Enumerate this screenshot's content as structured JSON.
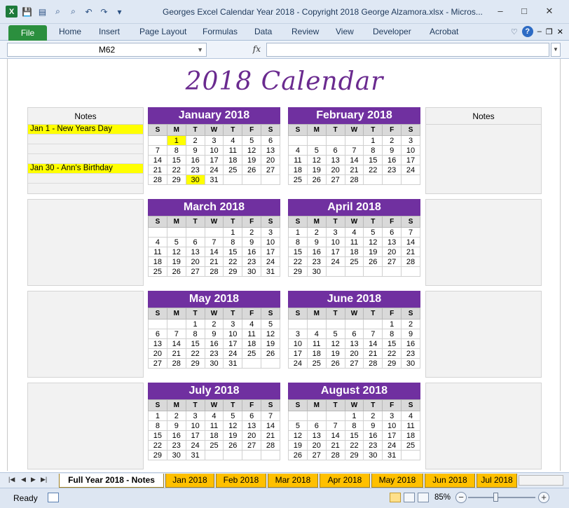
{
  "window": {
    "title": "Georges Excel Calendar Year 2018  -  Copyright 2018 George Alzamora.xlsx  -  Micros...",
    "minimize_glyph": "–",
    "maximize_glyph": "□",
    "close_glyph": "✕"
  },
  "quick_access": {
    "app_icon": "X",
    "save_glyph": "💾",
    "undo_glyph": "↶",
    "redo_glyph": "↷",
    "binoculars_glyph": "⌕",
    "more_glyph": "▾"
  },
  "ribbon": {
    "file_label": "File",
    "tabs": [
      "Home",
      "Insert",
      "Page Layout",
      "Formulas",
      "Data",
      "Review",
      "View",
      "Developer",
      "Acrobat"
    ],
    "help_glyph": "?"
  },
  "formula_bar": {
    "name_box_value": "M62",
    "fx_label": "fx",
    "formula_value": ""
  },
  "sheet": {
    "title": "2018 Calendar",
    "notes_header": "Notes",
    "notes_left": [
      "Jan 1 - New Years Day",
      "",
      "",
      "",
      "Jan 30 - Ann's Birthday",
      ""
    ],
    "weekday_headers": [
      "S",
      "M",
      "T",
      "W",
      "T",
      "F",
      "S"
    ],
    "months": [
      {
        "name": "January 2018",
        "weeks": [
          [
            "",
            "1",
            "2",
            "3",
            "4",
            "5",
            "6"
          ],
          [
            "7",
            "8",
            "9",
            "10",
            "11",
            "12",
            "13"
          ],
          [
            "14",
            "15",
            "16",
            "17",
            "18",
            "19",
            "20"
          ],
          [
            "21",
            "22",
            "23",
            "24",
            "25",
            "26",
            "27"
          ],
          [
            "28",
            "29",
            "30",
            "31",
            "",
            "",
            ""
          ]
        ],
        "highlight": [
          "1",
          "30"
        ]
      },
      {
        "name": "February 2018",
        "weeks": [
          [
            "",
            "",
            "",
            "",
            "1",
            "2",
            "3"
          ],
          [
            "4",
            "5",
            "6",
            "7",
            "8",
            "9",
            "10"
          ],
          [
            "11",
            "12",
            "13",
            "14",
            "15",
            "16",
            "17"
          ],
          [
            "18",
            "19",
            "20",
            "21",
            "22",
            "23",
            "24"
          ],
          [
            "25",
            "26",
            "27",
            "28",
            "",
            "",
            ""
          ]
        ],
        "highlight": []
      },
      {
        "name": "March 2018",
        "weeks": [
          [
            "",
            "",
            "",
            "",
            "1",
            "2",
            "3"
          ],
          [
            "4",
            "5",
            "6",
            "7",
            "8",
            "9",
            "10"
          ],
          [
            "11",
            "12",
            "13",
            "14",
            "15",
            "16",
            "17"
          ],
          [
            "18",
            "19",
            "20",
            "21",
            "22",
            "23",
            "24"
          ],
          [
            "25",
            "26",
            "27",
            "28",
            "29",
            "30",
            "31"
          ]
        ],
        "highlight": []
      },
      {
        "name": "April 2018",
        "weeks": [
          [
            "1",
            "2",
            "3",
            "4",
            "5",
            "6",
            "7"
          ],
          [
            "8",
            "9",
            "10",
            "11",
            "12",
            "13",
            "14"
          ],
          [
            "15",
            "16",
            "17",
            "18",
            "19",
            "20",
            "21"
          ],
          [
            "22",
            "23",
            "24",
            "25",
            "26",
            "27",
            "28"
          ],
          [
            "29",
            "30",
            "",
            "",
            "",
            "",
            ""
          ]
        ],
        "highlight": []
      },
      {
        "name": "May 2018",
        "weeks": [
          [
            "",
            "",
            "1",
            "2",
            "3",
            "4",
            "5"
          ],
          [
            "6",
            "7",
            "8",
            "9",
            "10",
            "11",
            "12"
          ],
          [
            "13",
            "14",
            "15",
            "16",
            "17",
            "18",
            "19"
          ],
          [
            "20",
            "21",
            "22",
            "23",
            "24",
            "25",
            "26"
          ],
          [
            "27",
            "28",
            "29",
            "30",
            "31",
            "",
            ""
          ]
        ],
        "highlight": []
      },
      {
        "name": "June 2018",
        "weeks": [
          [
            "",
            "",
            "",
            "",
            "",
            "1",
            "2"
          ],
          [
            "3",
            "4",
            "5",
            "6",
            "7",
            "8",
            "9"
          ],
          [
            "10",
            "11",
            "12",
            "13",
            "14",
            "15",
            "16"
          ],
          [
            "17",
            "18",
            "19",
            "20",
            "21",
            "22",
            "23"
          ],
          [
            "24",
            "25",
            "26",
            "27",
            "28",
            "29",
            "30"
          ]
        ],
        "highlight": []
      },
      {
        "name": "July 2018",
        "weeks": [
          [
            "1",
            "2",
            "3",
            "4",
            "5",
            "6",
            "7"
          ],
          [
            "8",
            "9",
            "10",
            "11",
            "12",
            "13",
            "14"
          ],
          [
            "15",
            "16",
            "17",
            "18",
            "19",
            "20",
            "21"
          ],
          [
            "22",
            "23",
            "24",
            "25",
            "26",
            "27",
            "28"
          ],
          [
            "29",
            "30",
            "31",
            "",
            "",
            "",
            ""
          ]
        ],
        "highlight": []
      },
      {
        "name": "August 2018",
        "weeks": [
          [
            "",
            "",
            "",
            "1",
            "2",
            "3",
            "4"
          ],
          [
            "5",
            "6",
            "7",
            "8",
            "9",
            "10",
            "11"
          ],
          [
            "12",
            "13",
            "14",
            "15",
            "16",
            "17",
            "18"
          ],
          [
            "19",
            "20",
            "21",
            "22",
            "23",
            "24",
            "25"
          ],
          [
            "26",
            "27",
            "28",
            "29",
            "30",
            "31",
            ""
          ]
        ],
        "highlight": []
      }
    ]
  },
  "sheet_tabs": {
    "nav_glyphs": [
      "|◀",
      "◀",
      "▶",
      "▶|"
    ],
    "tabs": [
      "Full Year 2018 - Notes",
      "Jan 2018",
      "Feb 2018",
      "Mar 2018",
      "Apr 2018",
      "May 2018",
      "Jun 2018",
      "Jul 2018"
    ],
    "active_index": 0
  },
  "status_bar": {
    "ready_label": "Ready",
    "zoom_value": "85%",
    "zoom_out_glyph": "−",
    "zoom_in_glyph": "+",
    "zoom_level": 0.85
  },
  "colors": {
    "month_header": "#7030a0",
    "highlight": "#ffff00",
    "sheet_tab": "#ffc000",
    "title": "#6a2a8f"
  }
}
